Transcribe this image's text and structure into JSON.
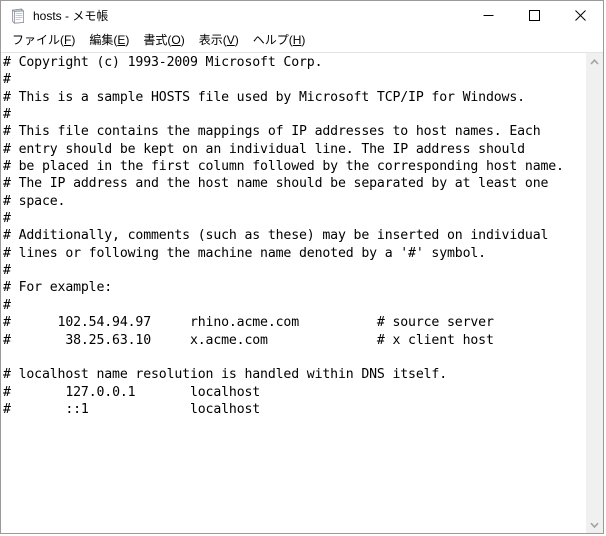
{
  "window": {
    "title": "hosts - メモ帳",
    "icon": "notepad-icon",
    "controls": {
      "minimize_label": "最小化",
      "maximize_label": "最大化",
      "close_label": "閉じる"
    }
  },
  "menubar": {
    "items": [
      {
        "label": "ファイル(F)",
        "text": "ファイル(",
        "accel": "F",
        "tail": ")"
      },
      {
        "label": "編集(E)",
        "text": "編集(",
        "accel": "E",
        "tail": ")"
      },
      {
        "label": "書式(O)",
        "text": "書式(",
        "accel": "O",
        "tail": ")"
      },
      {
        "label": "表示(V)",
        "text": "表示(",
        "accel": "V",
        "tail": ")"
      },
      {
        "label": "ヘルプ(H)",
        "text": "ヘルプ(",
        "accel": "H",
        "tail": ")"
      }
    ]
  },
  "editor": {
    "filename": "hosts",
    "content": "# Copyright (c) 1993-2009 Microsoft Corp.\n#\n# This is a sample HOSTS file used by Microsoft TCP/IP for Windows.\n#\n# This file contains the mappings of IP addresses to host names. Each\n# entry should be kept on an individual line. The IP address should\n# be placed in the first column followed by the corresponding host name.\n# The IP address and the host name should be separated by at least one\n# space.\n#\n# Additionally, comments (such as these) may be inserted on individual\n# lines or following the machine name denoted by a '#' symbol.\n#\n# For example:\n#\n#      102.54.94.97     rhino.acme.com          # source server\n#       38.25.63.10     x.acme.com              # x client host\n\n# localhost name resolution is handled within DNS itself.\n#\t127.0.0.1       localhost\n#\t::1             localhost\n"
  },
  "scrollbar": {
    "up_arrow": "chevron-up-icon",
    "down_arrow": "chevron-down-icon"
  },
  "colors": {
    "window_border": "#9a9a9a",
    "scrollbar_track": "#f0f0f0",
    "scrollbar_arrow": "#a0a0a0",
    "text": "#000000",
    "background": "#ffffff"
  }
}
